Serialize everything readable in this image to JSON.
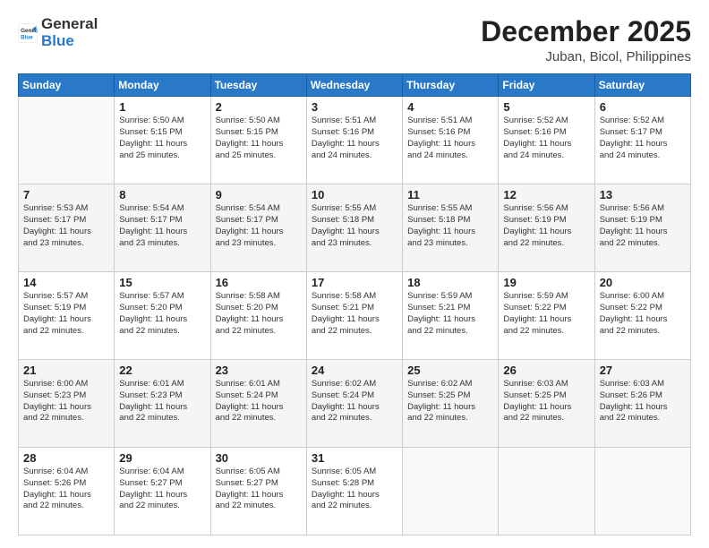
{
  "header": {
    "logo_general": "General",
    "logo_blue": "Blue",
    "month": "December 2025",
    "location": "Juban, Bicol, Philippines"
  },
  "days_of_week": [
    "Sunday",
    "Monday",
    "Tuesday",
    "Wednesday",
    "Thursday",
    "Friday",
    "Saturday"
  ],
  "weeks": [
    [
      {
        "day": "",
        "info": ""
      },
      {
        "day": "1",
        "info": "Sunrise: 5:50 AM\nSunset: 5:15 PM\nDaylight: 11 hours\nand 25 minutes."
      },
      {
        "day": "2",
        "info": "Sunrise: 5:50 AM\nSunset: 5:15 PM\nDaylight: 11 hours\nand 25 minutes."
      },
      {
        "day": "3",
        "info": "Sunrise: 5:51 AM\nSunset: 5:16 PM\nDaylight: 11 hours\nand 24 minutes."
      },
      {
        "day": "4",
        "info": "Sunrise: 5:51 AM\nSunset: 5:16 PM\nDaylight: 11 hours\nand 24 minutes."
      },
      {
        "day": "5",
        "info": "Sunrise: 5:52 AM\nSunset: 5:16 PM\nDaylight: 11 hours\nand 24 minutes."
      },
      {
        "day": "6",
        "info": "Sunrise: 5:52 AM\nSunset: 5:17 PM\nDaylight: 11 hours\nand 24 minutes."
      }
    ],
    [
      {
        "day": "7",
        "info": "Sunrise: 5:53 AM\nSunset: 5:17 PM\nDaylight: 11 hours\nand 23 minutes."
      },
      {
        "day": "8",
        "info": "Sunrise: 5:54 AM\nSunset: 5:17 PM\nDaylight: 11 hours\nand 23 minutes."
      },
      {
        "day": "9",
        "info": "Sunrise: 5:54 AM\nSunset: 5:17 PM\nDaylight: 11 hours\nand 23 minutes."
      },
      {
        "day": "10",
        "info": "Sunrise: 5:55 AM\nSunset: 5:18 PM\nDaylight: 11 hours\nand 23 minutes."
      },
      {
        "day": "11",
        "info": "Sunrise: 5:55 AM\nSunset: 5:18 PM\nDaylight: 11 hours\nand 23 minutes."
      },
      {
        "day": "12",
        "info": "Sunrise: 5:56 AM\nSunset: 5:19 PM\nDaylight: 11 hours\nand 22 minutes."
      },
      {
        "day": "13",
        "info": "Sunrise: 5:56 AM\nSunset: 5:19 PM\nDaylight: 11 hours\nand 22 minutes."
      }
    ],
    [
      {
        "day": "14",
        "info": "Sunrise: 5:57 AM\nSunset: 5:19 PM\nDaylight: 11 hours\nand 22 minutes."
      },
      {
        "day": "15",
        "info": "Sunrise: 5:57 AM\nSunset: 5:20 PM\nDaylight: 11 hours\nand 22 minutes."
      },
      {
        "day": "16",
        "info": "Sunrise: 5:58 AM\nSunset: 5:20 PM\nDaylight: 11 hours\nand 22 minutes."
      },
      {
        "day": "17",
        "info": "Sunrise: 5:58 AM\nSunset: 5:21 PM\nDaylight: 11 hours\nand 22 minutes."
      },
      {
        "day": "18",
        "info": "Sunrise: 5:59 AM\nSunset: 5:21 PM\nDaylight: 11 hours\nand 22 minutes."
      },
      {
        "day": "19",
        "info": "Sunrise: 5:59 AM\nSunset: 5:22 PM\nDaylight: 11 hours\nand 22 minutes."
      },
      {
        "day": "20",
        "info": "Sunrise: 6:00 AM\nSunset: 5:22 PM\nDaylight: 11 hours\nand 22 minutes."
      }
    ],
    [
      {
        "day": "21",
        "info": "Sunrise: 6:00 AM\nSunset: 5:23 PM\nDaylight: 11 hours\nand 22 minutes."
      },
      {
        "day": "22",
        "info": "Sunrise: 6:01 AM\nSunset: 5:23 PM\nDaylight: 11 hours\nand 22 minutes."
      },
      {
        "day": "23",
        "info": "Sunrise: 6:01 AM\nSunset: 5:24 PM\nDaylight: 11 hours\nand 22 minutes."
      },
      {
        "day": "24",
        "info": "Sunrise: 6:02 AM\nSunset: 5:24 PM\nDaylight: 11 hours\nand 22 minutes."
      },
      {
        "day": "25",
        "info": "Sunrise: 6:02 AM\nSunset: 5:25 PM\nDaylight: 11 hours\nand 22 minutes."
      },
      {
        "day": "26",
        "info": "Sunrise: 6:03 AM\nSunset: 5:25 PM\nDaylight: 11 hours\nand 22 minutes."
      },
      {
        "day": "27",
        "info": "Sunrise: 6:03 AM\nSunset: 5:26 PM\nDaylight: 11 hours\nand 22 minutes."
      }
    ],
    [
      {
        "day": "28",
        "info": "Sunrise: 6:04 AM\nSunset: 5:26 PM\nDaylight: 11 hours\nand 22 minutes."
      },
      {
        "day": "29",
        "info": "Sunrise: 6:04 AM\nSunset: 5:27 PM\nDaylight: 11 hours\nand 22 minutes."
      },
      {
        "day": "30",
        "info": "Sunrise: 6:05 AM\nSunset: 5:27 PM\nDaylight: 11 hours\nand 22 minutes."
      },
      {
        "day": "31",
        "info": "Sunrise: 6:05 AM\nSunset: 5:28 PM\nDaylight: 11 hours\nand 22 minutes."
      },
      {
        "day": "",
        "info": ""
      },
      {
        "day": "",
        "info": ""
      },
      {
        "day": "",
        "info": ""
      }
    ]
  ]
}
